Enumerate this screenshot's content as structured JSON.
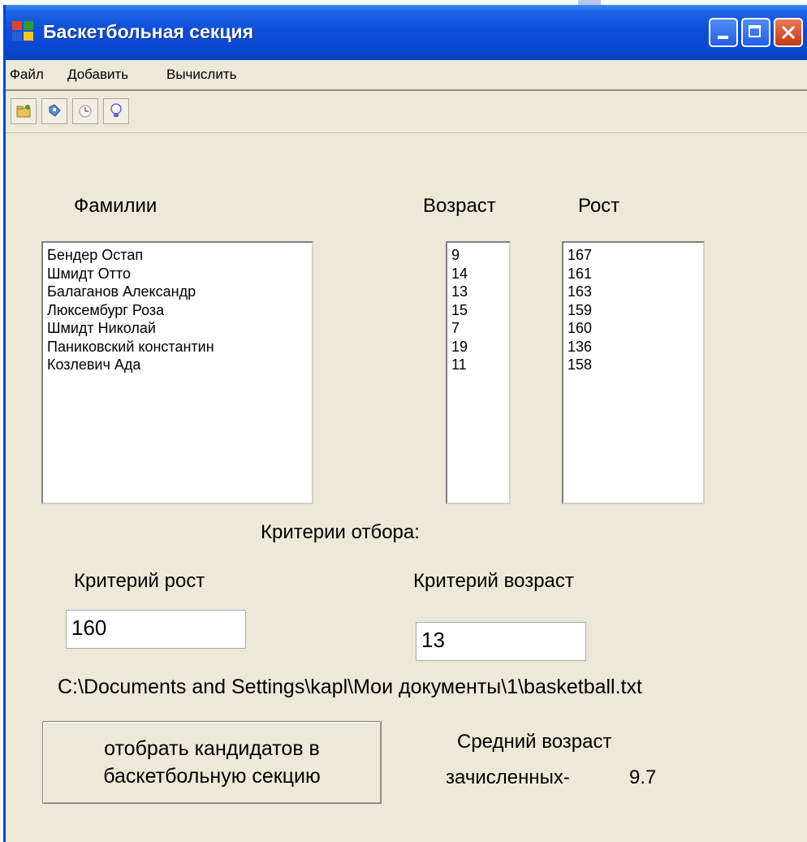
{
  "window": {
    "title": "Баскетбольная секция"
  },
  "menu": [
    "Файл",
    "Добавить",
    "Вычислить"
  ],
  "toolbar_icons": [
    "open-folder-icon",
    "save-disk-icon",
    "clock-icon",
    "lightbulb-icon"
  ],
  "headers": {
    "surnames": "Фамилии",
    "age": "Возраст",
    "height": "Рост"
  },
  "surnames": [
    "Бендер Остап",
    "Шмидт Отто",
    "Балаганов Александр",
    "Люксембург Роза",
    "Шмидт Николай",
    "Паниковский константин",
    "Козлевич Ада"
  ],
  "ages": [
    "9",
    "14",
    "13",
    "15",
    "7",
    "19",
    "11"
  ],
  "heights": [
    "167",
    "161",
    "163",
    "159",
    "160",
    "136",
    "158"
  ],
  "criteria": {
    "title": "Критерии отбора:",
    "height_label": "Критерий рост",
    "height_value": "160",
    "age_label": "Критерий возраст",
    "age_value": "13"
  },
  "file_path": "C:\\Documents  and  Settings\\kapl\\Мои  документы\\1\\basketball.txt",
  "action_button": {
    "line1": "отобрать кандидатов в",
    "line2": "баскетбольную секцию"
  },
  "result": {
    "line1": "Средний возраст",
    "line2_label": "зачисленных-",
    "value": "9.7"
  },
  "colors": {
    "titlebar": "#0a47cf",
    "window_bg": "#ece9d8",
    "close_button": "#c23a14"
  }
}
